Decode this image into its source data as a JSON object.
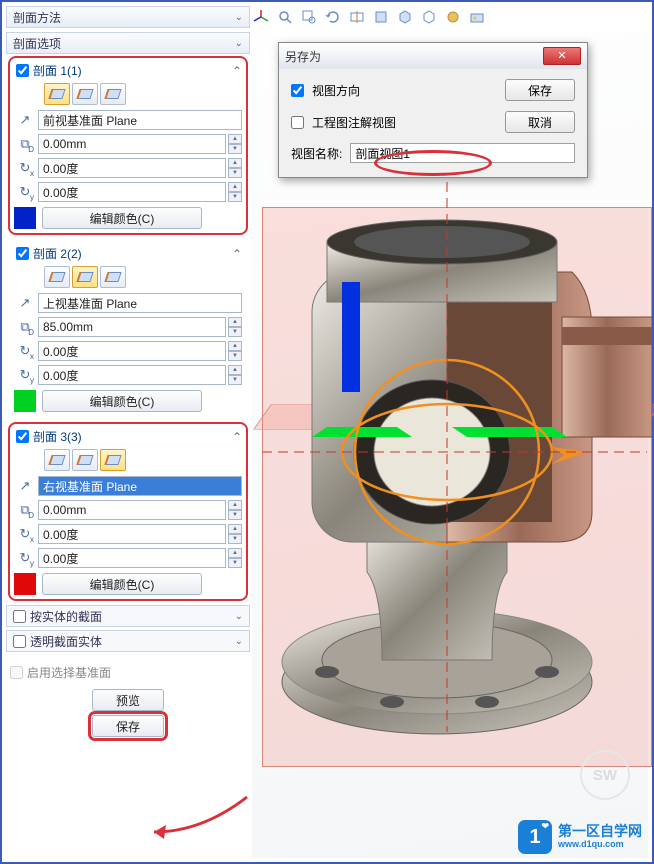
{
  "headers": {
    "method": "剖面方法",
    "options": "剖面选项"
  },
  "s1": {
    "title": "剖面 1(1)",
    "plane": "前视基准面 Plane",
    "d": "0.00mm",
    "ax": "0.00度",
    "ay": "0.00度",
    "color": "#0022c8",
    "edit": "编辑颜色(C)"
  },
  "s2": {
    "title": "剖面 2(2)",
    "plane": "上视基准面 Plane",
    "d": "85.00mm",
    "ax": "0.00度",
    "ay": "0.00度",
    "color": "#00d020",
    "edit": "编辑颜色(C)"
  },
  "s3": {
    "title": "剖面 3(3)",
    "plane": "右视基准面 Plane",
    "d": "0.00mm",
    "ax": "0.00度",
    "ay": "0.00度",
    "color": "#e00808",
    "edit": "编辑颜色(C)"
  },
  "opts": {
    "bySolid": "按实体的截面",
    "transparent": "透明截面实体",
    "enableSel": "启用选择基准面",
    "preview": "预览",
    "save": "保存"
  },
  "dialog": {
    "title": "另存为",
    "viewDir": "视图方向",
    "annot": "工程图注解视图",
    "nameLabel": "视图名称:",
    "nameVal": "剖面视图1",
    "save": "保存",
    "cancel": "取消"
  },
  "logo": {
    "one": "1",
    "line1": "第一区自学网",
    "line2": "www.d1qu.com"
  }
}
